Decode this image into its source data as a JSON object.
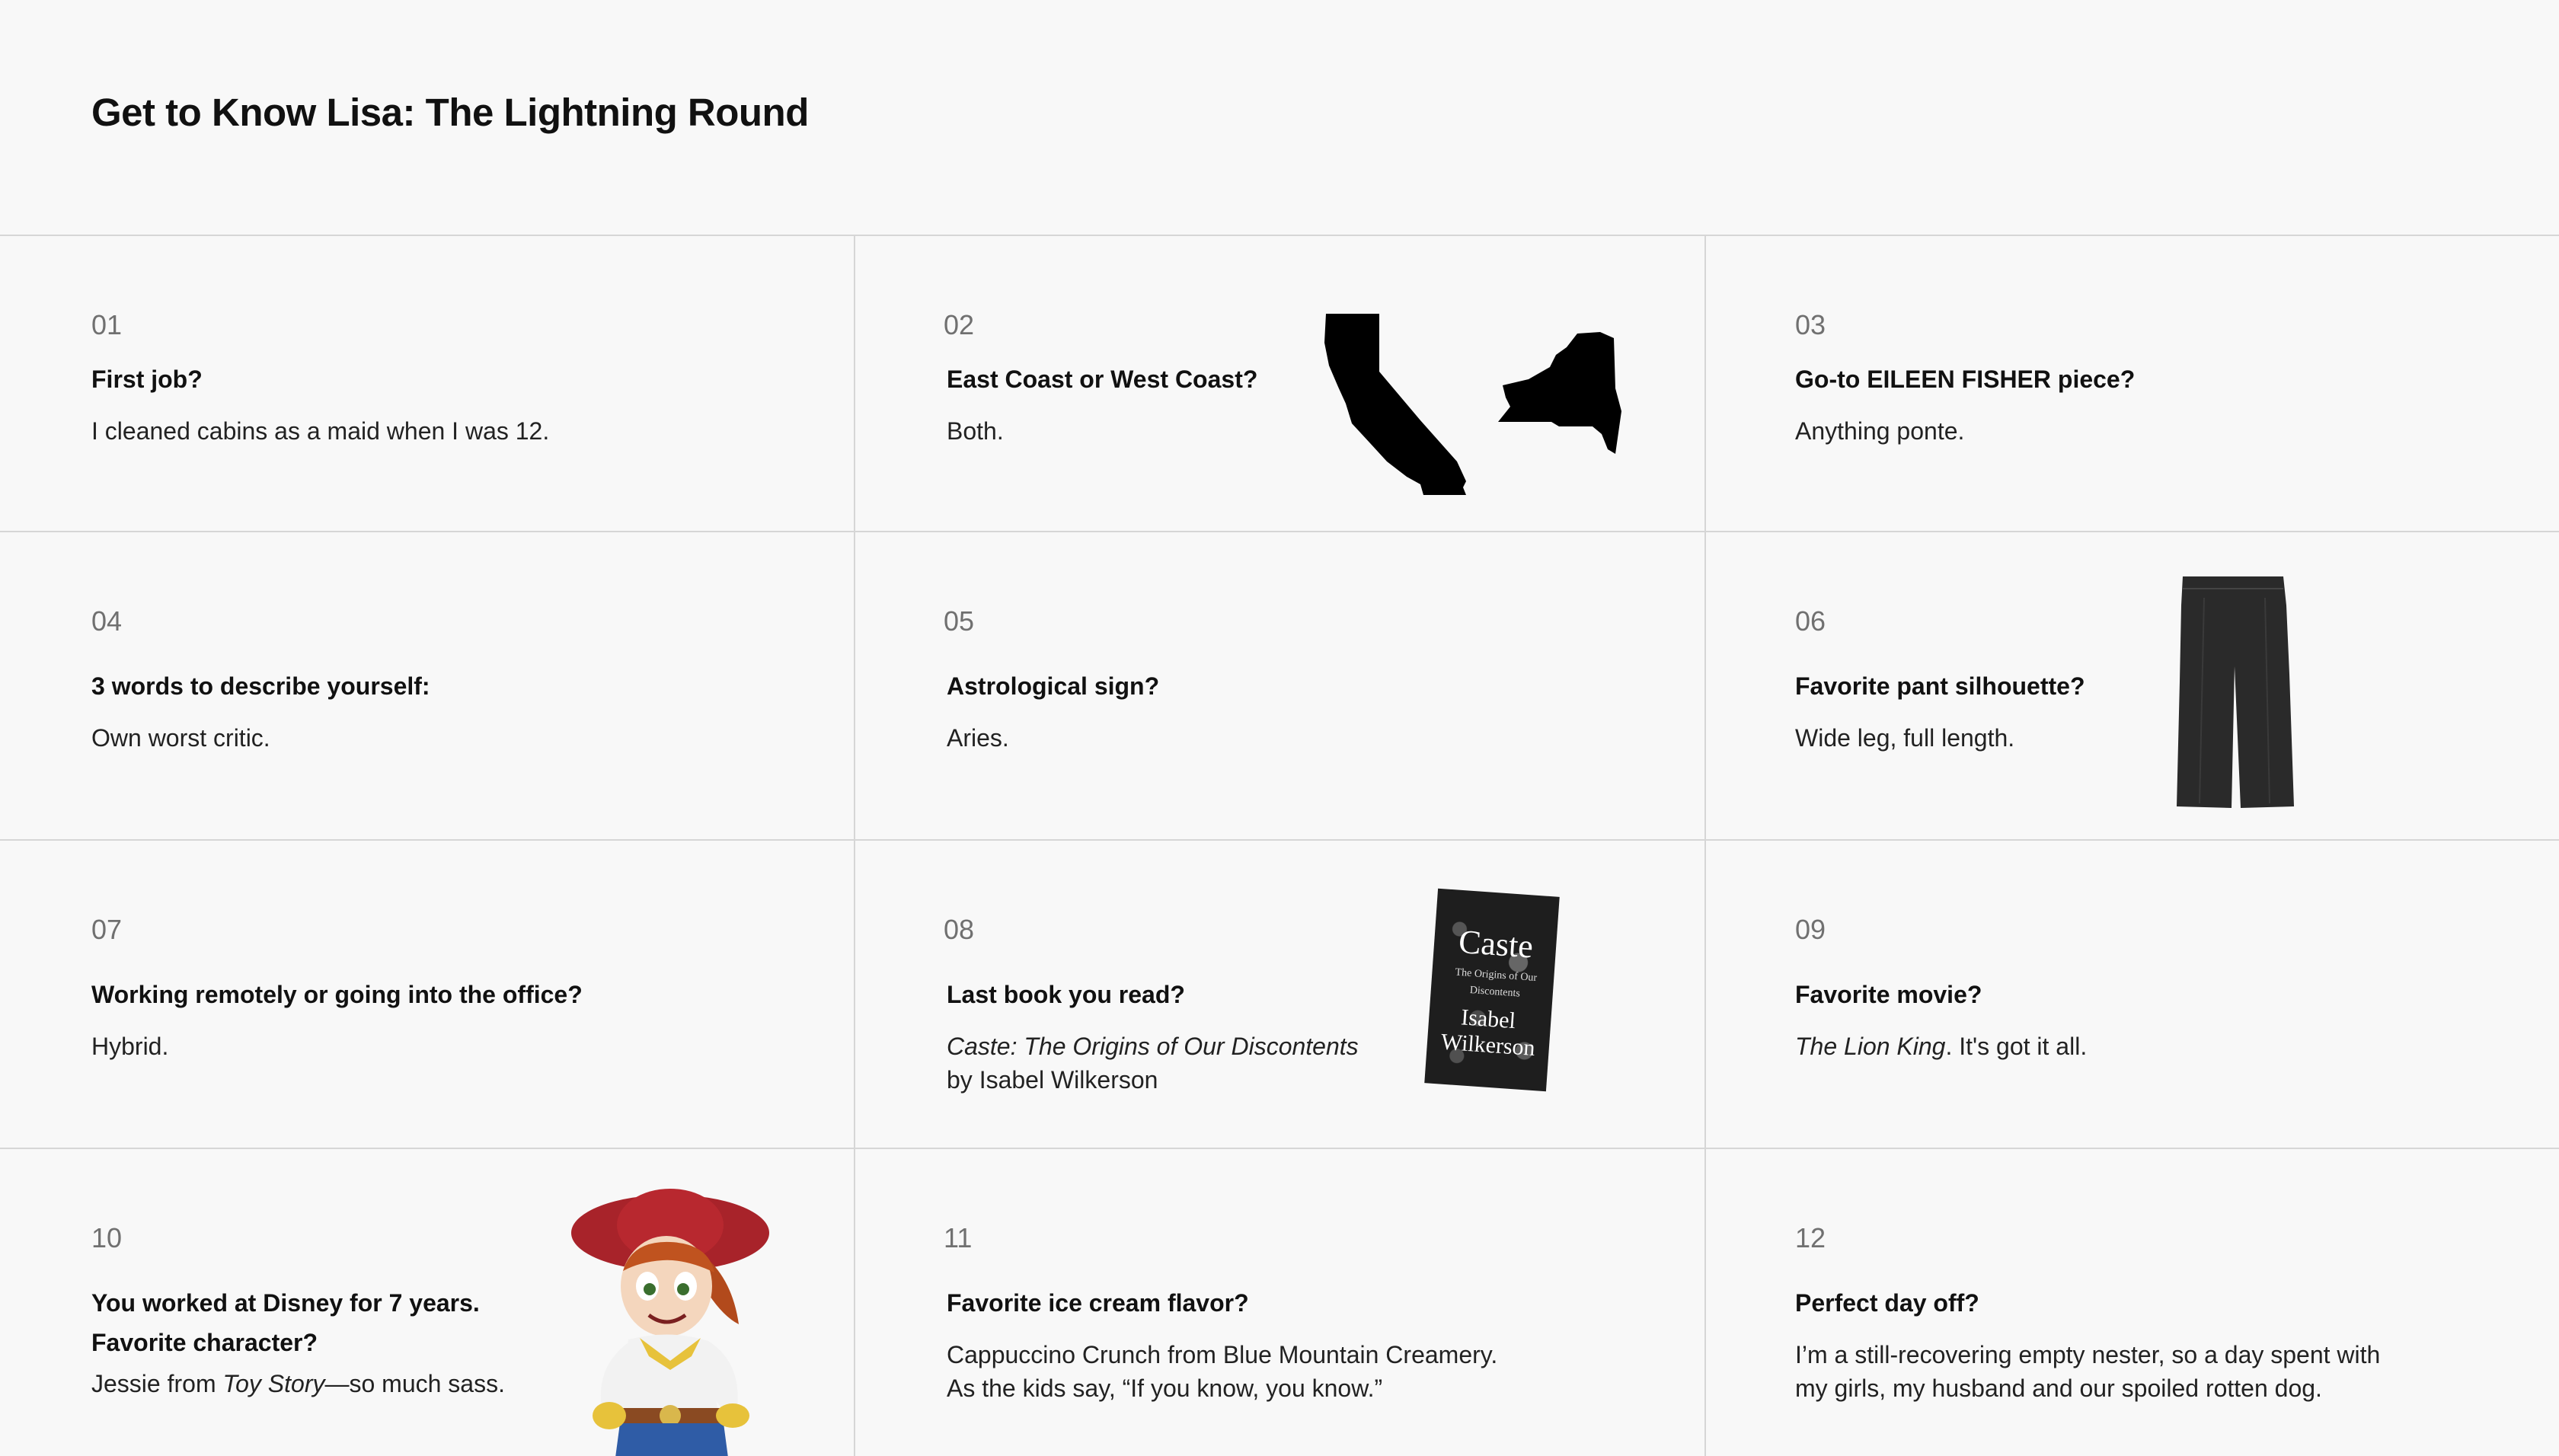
{
  "title": "Get to Know Lisa: The Lightning Round",
  "items": [
    {
      "num": "01",
      "question": "First job?",
      "answer": "I cleaned cabins as a maid when I was 12."
    },
    {
      "num": "02",
      "question": "East Coast or West Coast?",
      "answer": "Both."
    },
    {
      "num": "03",
      "question": "Go-to EILEEN FISHER piece?",
      "answer": "Anything ponte."
    },
    {
      "num": "04",
      "question": "3 words to describe yourself:",
      "answer": "Own worst critic."
    },
    {
      "num": "05",
      "question": "Astrological sign?",
      "answer": "Aries."
    },
    {
      "num": "06",
      "question": "Favorite pant silhouette?",
      "answer": "Wide leg, full length."
    },
    {
      "num": "07",
      "question": "Working remotely or going into the office?",
      "answer": "Hybrid."
    },
    {
      "num": "08",
      "question": "Last book you read?",
      "answer_italic": "Caste: The Origins of Our Discontents",
      "answer_line2": "by Isabel Wilkerson"
    },
    {
      "num": "09",
      "question": "Favorite movie?",
      "answer_italic": "The Lion King",
      "answer_rest": ". It's got it all."
    },
    {
      "num": "10",
      "question_line1": "You worked at Disney for 7 years.",
      "question_line2": "Favorite character?",
      "answer_pre": "Jessie from ",
      "answer_italic": "Toy Story",
      "answer_rest": "—so much sass."
    },
    {
      "num": "11",
      "question": "Favorite ice cream flavor?",
      "answer_line1": "Cappuccino Crunch from Blue Mountain Creamery.",
      "answer_line2": "As the kids say, “If you know, you know.”"
    },
    {
      "num": "12",
      "question": "Perfect day off?",
      "answer_line1": "I’m a still-recovering empty nester, so a day spent with",
      "answer_line2": "my girls, my husband and our spoiled rotten dog."
    }
  ],
  "book_cover": {
    "title": "Caste",
    "subtitle": "The Origins of Our Discontents",
    "author_first": "Isabel",
    "author_last": "Wilkerson"
  },
  "colors": {
    "background": "#f8f8f8",
    "divider": "#d6d6d6",
    "text": "#111111",
    "muted": "#707070"
  }
}
